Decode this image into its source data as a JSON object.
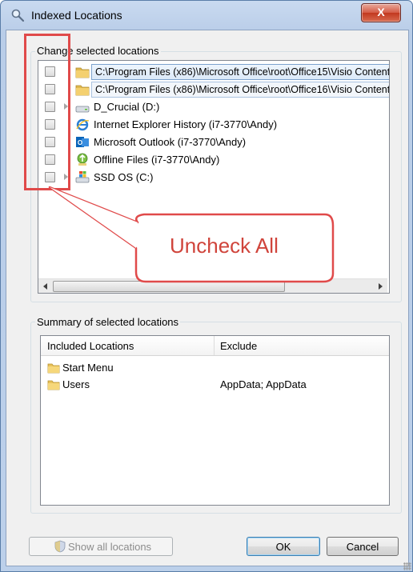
{
  "window": {
    "title": "Indexed Locations",
    "close_glyph": "X"
  },
  "change_group": {
    "legend": "Change selected locations",
    "rows": [
      {
        "label": "C:\\Program Files (x86)\\Microsoft Office\\root\\Office15\\Visio Content",
        "icon": "folder-icon",
        "expander": false,
        "boxed": true
      },
      {
        "label": "C:\\Program Files (x86)\\Microsoft Office\\root\\Office16\\Visio Content",
        "icon": "folder-icon",
        "expander": false,
        "boxed": true
      },
      {
        "label": "D_Crucial (D:)",
        "icon": "drive-icon",
        "expander": true,
        "boxed": false
      },
      {
        "label": "Internet Explorer History (i7-3770\\Andy)",
        "icon": "internet-explorer-icon",
        "expander": false,
        "boxed": false
      },
      {
        "label": "Microsoft Outlook (i7-3770\\Andy)",
        "icon": "outlook-icon",
        "expander": false,
        "boxed": false
      },
      {
        "label": "Offline Files (i7-3770\\Andy)",
        "icon": "offline-files-icon",
        "expander": false,
        "boxed": false
      },
      {
        "label": "SSD OS (C:)",
        "icon": "windows-drive-icon",
        "expander": true,
        "boxed": false
      }
    ]
  },
  "annotation": {
    "text": "Uncheck All",
    "color": "#e04a4a"
  },
  "summary_group": {
    "legend": "Summary of selected locations",
    "columns": [
      "Included Locations",
      "Exclude"
    ],
    "rows": [
      {
        "name": "Start Menu",
        "exclude": ""
      },
      {
        "name": "Users",
        "exclude": "AppData; AppData"
      }
    ]
  },
  "buttons": {
    "show_all": "Show all locations",
    "ok": "OK",
    "cancel": "Cancel"
  }
}
